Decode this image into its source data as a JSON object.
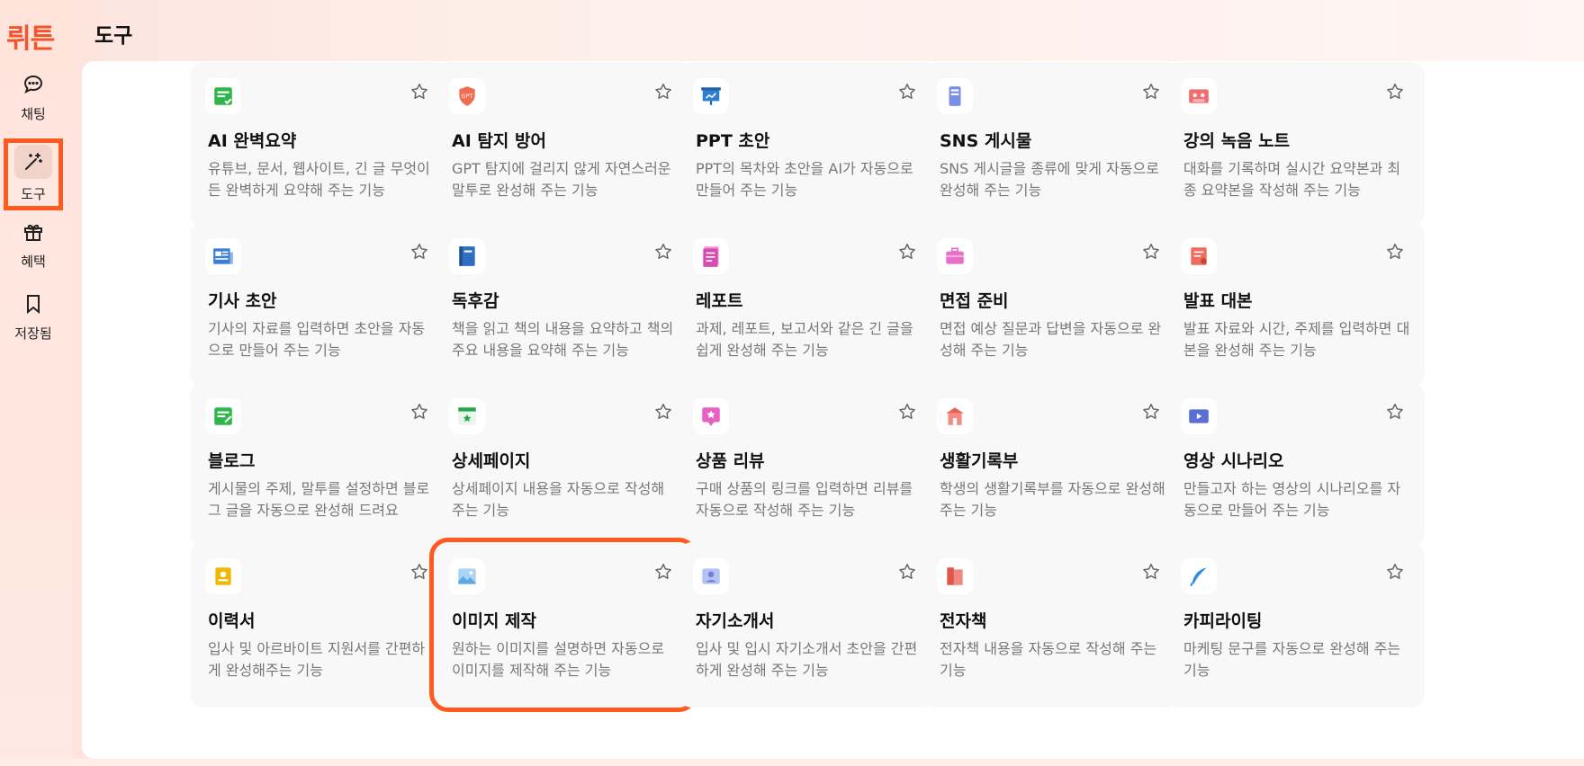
{
  "app": {
    "logo": "뤼튼"
  },
  "sidebar": {
    "items": [
      {
        "label": "채팅",
        "icon": "chat-bubble-icon"
      },
      {
        "label": "도구",
        "icon": "magic-wand-icon",
        "active": true
      },
      {
        "label": "혜택",
        "icon": "gift-icon"
      },
      {
        "label": "저장됨",
        "icon": "bookmark-icon"
      }
    ]
  },
  "header": {
    "title": "도구"
  },
  "tools": [
    {
      "title": "AI 완벽요약",
      "desc": "유튜브, 문서, 웹사이트, 긴 글 무엇이든 완벽하게 요약해 주는 기능",
      "icon": "summary-icon",
      "color": "#2fb64a"
    },
    {
      "title": "AI 탐지 방어",
      "desc": "GPT 탐지에 걸리지 않게 자연스러운 말투로 완성해 주는 기능",
      "icon": "gpt-shield-icon",
      "color": "#f06d52"
    },
    {
      "title": "PPT 초안",
      "desc": "PPT의 목차와 초안을 AI가 자동으로 만들어 주는 기능",
      "icon": "presentation-icon",
      "color": "#2b7fd4"
    },
    {
      "title": "SNS 게시물",
      "desc": "SNS 게시글을 종류에 맞게 자동으로 완성해 주는 기능",
      "icon": "phone-icon",
      "color": "#7b8ee6"
    },
    {
      "title": "강의 녹음 노트",
      "desc": "대화를 기록하며 실시간 요약본과 최종 요약본을 작성해 주는 기능",
      "icon": "cassette-icon",
      "color": "#f26d6d"
    },
    {
      "title": "기사 초안",
      "desc": "기사의 자료를 입력하면 초안을 자동으로 만들어 주는 기능",
      "icon": "newspaper-icon",
      "color": "#3b7dd8"
    },
    {
      "title": "독후감",
      "desc": "책을 읽고 책의 내용을 요약하고 책의 주요 내용을 요약해 주는 기능",
      "icon": "book-icon",
      "color": "#2f6fbf"
    },
    {
      "title": "레포트",
      "desc": "과제, 레포트, 보고서와 같은 긴 글을 쉽게 완성해 주는 기능",
      "icon": "report-icon",
      "color": "#d94bb0"
    },
    {
      "title": "면접 준비",
      "desc": "면접 예상 질문과 답변을 자동으로 완성해 주는 기능",
      "icon": "briefcase-icon",
      "color": "#e86fc6"
    },
    {
      "title": "발표 대본",
      "desc": "발표 자료와 시간, 주제를 입력하면 대본을 완성해 주는 기능",
      "icon": "script-icon",
      "color": "#ef6b5b"
    },
    {
      "title": "블로그",
      "desc": "게시물의 주제, 말투를 설정하면 블로그 글을 자동으로 완성해 드려요",
      "icon": "blog-icon",
      "color": "#2fb64a"
    },
    {
      "title": "상세페이지",
      "desc": "상세페이지 내용을 자동으로 작성해 주는 기능",
      "icon": "webpage-star-icon",
      "color": "#27a74a"
    },
    {
      "title": "상품 리뷰",
      "desc": "구매 상품의 링크를 입력하면 리뷰를 자동으로 작성해 주는 기능",
      "icon": "review-icon",
      "color": "#e85fc4"
    },
    {
      "title": "생활기록부",
      "desc": "학생의 생활기록부를 자동으로 완성해 주는 기능",
      "icon": "school-icon",
      "color": "#e9605a"
    },
    {
      "title": "영상 시나리오",
      "desc": "만들고자 하는 영상의 시나리오를 자동으로 만들어 주는 기능",
      "icon": "video-icon",
      "color": "#5a6fd6"
    },
    {
      "title": "이력서",
      "desc": "입사 및 아르바이트 지원서를 간편하게 완성해주는 기능",
      "icon": "resume-icon",
      "color": "#f2b705"
    },
    {
      "title": "이미지 제작",
      "desc": "원하는 이미지를 설명하면 자동으로 이미지를 제작해 주는 기능",
      "icon": "image-icon",
      "color": "#5aa9e6",
      "highlighted": true
    },
    {
      "title": "자기소개서",
      "desc": "입사 및 입시 자기소개서 초안을 간편하게 완성해 주는 기능",
      "icon": "profile-card-icon",
      "color": "#6b7fdc"
    },
    {
      "title": "전자책",
      "desc": "전자책 내용을 자동으로 작성해 주는 기능",
      "icon": "ebook-icon",
      "color": "#e0564b"
    },
    {
      "title": "카피라이팅",
      "desc": "마케팅 문구를 자동으로 완성해 주는 기능",
      "icon": "quill-icon",
      "color": "#2f8fe0"
    }
  ]
}
